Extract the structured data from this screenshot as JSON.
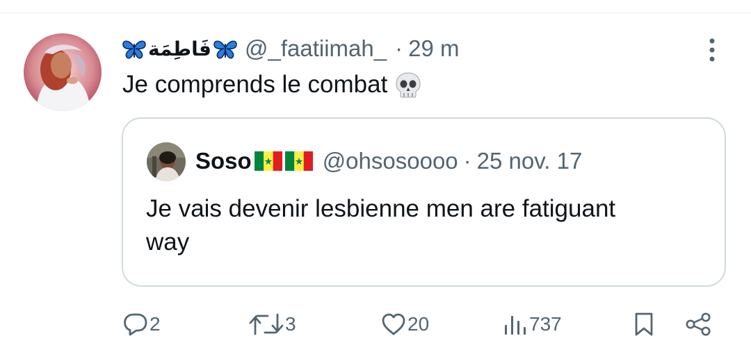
{
  "tweet": {
    "display_name_arabic": "فَاطِمَة",
    "handle": "@_faatiimah_",
    "separator": "·",
    "time": "29 m",
    "text": "Je comprends le combat",
    "emoji_icon": "skull-emoji-icon"
  },
  "quoted_tweet": {
    "display_name": "Soso",
    "flags": [
      "senegal-flag-icon",
      "senegal-flag-icon"
    ],
    "handle": "@ohsosoooo",
    "separator": "·",
    "time": "25 nov. 17",
    "text": "Je vais devenir lesbienne men are fatiguant way"
  },
  "actions": {
    "replies": "2",
    "retweets": "3",
    "likes": "20",
    "views": "737"
  },
  "colors": {
    "text_primary": "#0f1419",
    "text_secondary": "#536471",
    "border": "#cfd9de",
    "butterfly_blue": "#1e6fd9"
  }
}
